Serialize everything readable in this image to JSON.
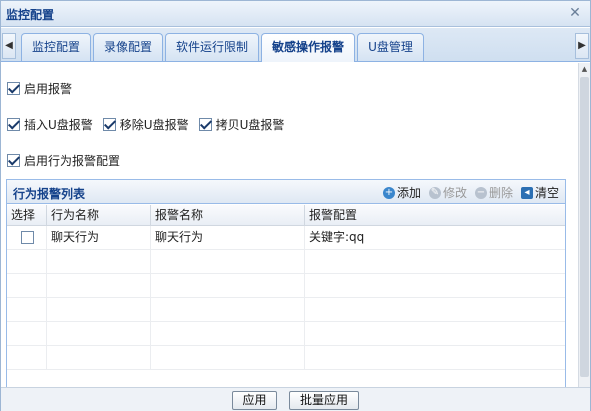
{
  "window": {
    "title": "监控配置"
  },
  "tabs": [
    {
      "label": "监控配置"
    },
    {
      "label": "录像配置"
    },
    {
      "label": "软件运行限制"
    },
    {
      "label": "敏感操作报警"
    },
    {
      "label": "U盘管理"
    }
  ],
  "active_tab": "敏感操作报警",
  "options": {
    "enable_alarm": {
      "label": "启用报警",
      "checked": true
    },
    "insert_usb": {
      "label": "插入U盘报警",
      "checked": true
    },
    "remove_usb": {
      "label": "移除U盘报警",
      "checked": true
    },
    "copy_usb": {
      "label": "拷贝U盘报警",
      "checked": true
    },
    "enable_behavior": {
      "label": "启用行为报警配置",
      "checked": true
    }
  },
  "panel": {
    "title": "行为报警列表",
    "toolbar": {
      "add": "添加",
      "edit": "修改",
      "delete": "删除",
      "clear": "清空"
    }
  },
  "grid": {
    "columns": [
      "选择",
      "行为名称",
      "报警名称",
      "报警配置"
    ],
    "rows": [
      {
        "selected": false,
        "behavior": "聊天行为",
        "alarm": "聊天行为",
        "config": "关键字:qq"
      }
    ]
  },
  "footer": {
    "apply": "应用",
    "batch_apply": "批量应用"
  },
  "colors": {
    "accent": "#15428b",
    "border": "#99bbe8"
  }
}
